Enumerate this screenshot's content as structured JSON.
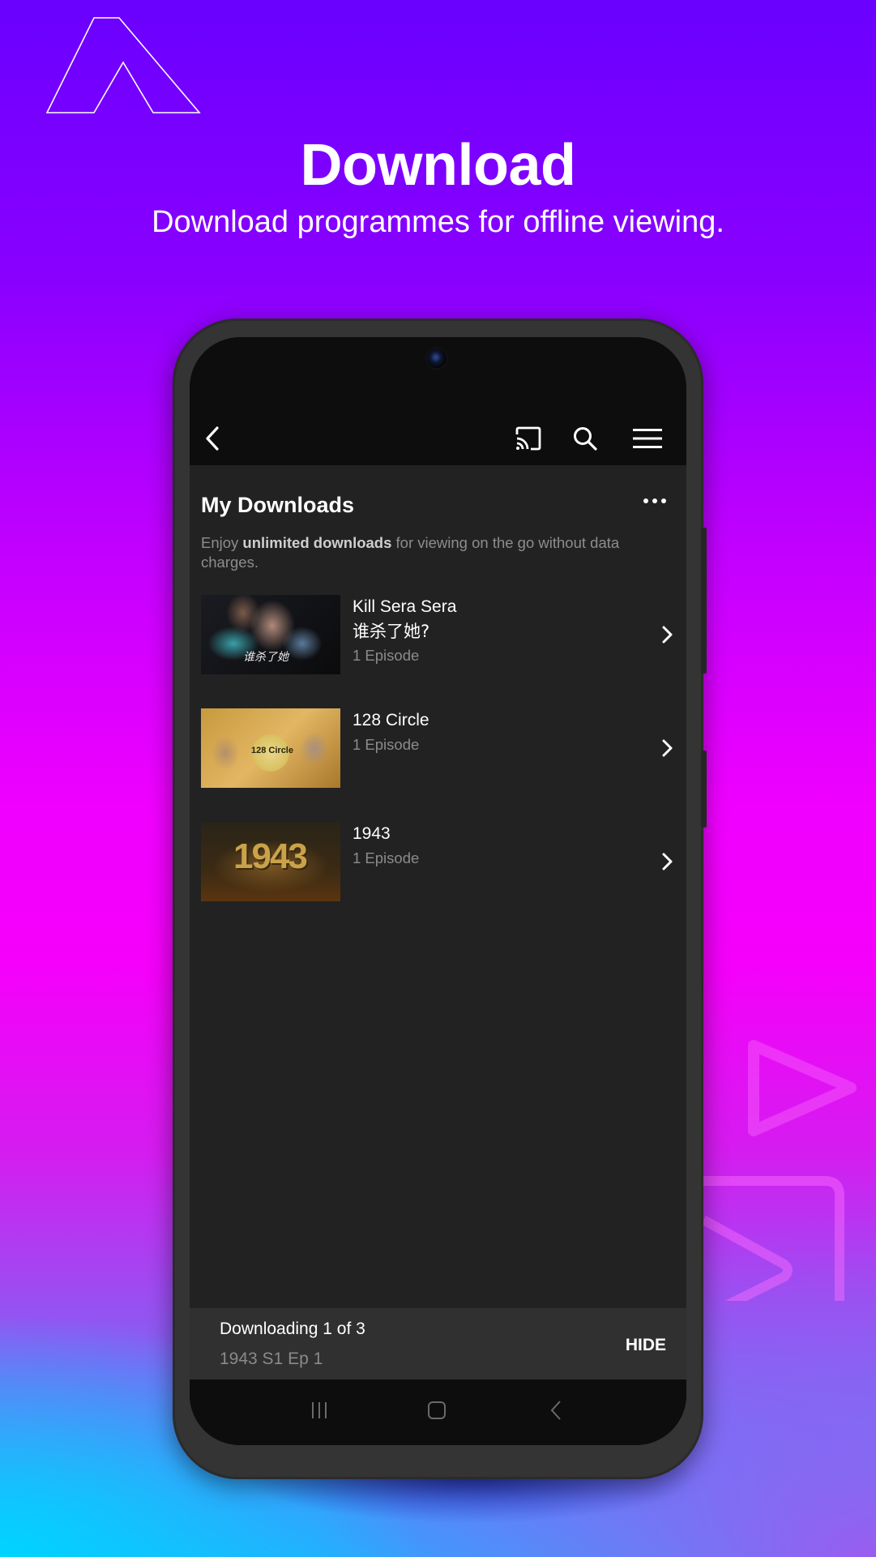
{
  "promo": {
    "title": "Download",
    "subtitle": "Download programmes for offline viewing.",
    "brand_logo": "a-outline-logo",
    "colors": {
      "gradient_top": "#6a00ff",
      "gradient_mid": "#f000ff",
      "gradient_bottom": "#00d4ff"
    }
  },
  "app_bar": {
    "back_icon": "chevron-left-icon",
    "cast_icon": "cast-icon",
    "search_icon": "search-icon",
    "menu_icon": "hamburger-menu-icon"
  },
  "page": {
    "title": "My Downloads",
    "more_icon": "more-horizontal-icon",
    "description_prefix": "Enjoy ",
    "description_bold": "unlimited downloads",
    "description_suffix": " for viewing on the go without data charges."
  },
  "downloads": [
    {
      "title": "Kill Sera Sera",
      "alt_title": "谁杀了她?",
      "episodes": "1 Episode",
      "thumb_text": "谁杀了她"
    },
    {
      "title": "128 Circle",
      "alt_title": null,
      "episodes": "1 Episode",
      "thumb_text": "128 Circle"
    },
    {
      "title": "1943",
      "alt_title": null,
      "episodes": "1 Episode",
      "thumb_text": "1943"
    }
  ],
  "download_status": {
    "title": "Downloading 1 of 3",
    "current": "1943 S1 Ep 1",
    "hide_label": "HIDE"
  },
  "system_nav": {
    "recents_icon": "recents-icon",
    "home_icon": "home-icon",
    "back_icon": "back-icon"
  }
}
